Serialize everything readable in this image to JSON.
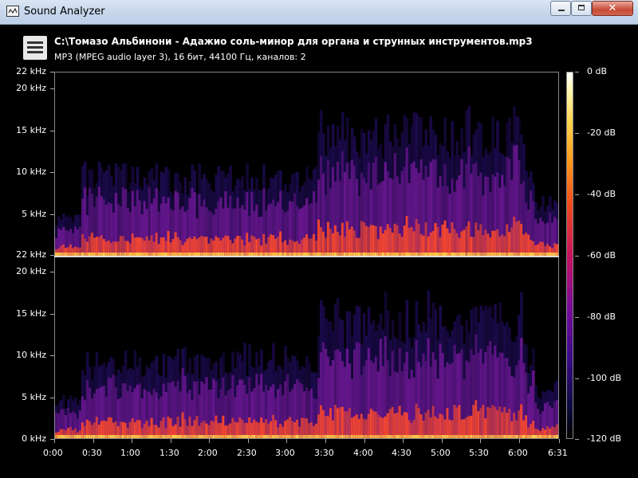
{
  "window": {
    "title": "Sound Analyzer",
    "close_label": "✕"
  },
  "header": {
    "file_path": "C:\\Томазо Альбинони - Адажио соль-минор для органа и струнных инструментов.mp3",
    "file_info": "MP3 (MPEG audio layer 3), 16 бит, 44100 Гц, каналов: 2"
  },
  "spectrogram": {
    "channels": 2,
    "top_channel_freq_labels": [
      "22 kHz",
      "20 kHz",
      "15 kHz",
      "10 kHz",
      "5 kHz"
    ],
    "bottom_channel_freq_labels": [
      "22 kHz",
      "20 kHz",
      "15 kHz",
      "10 kHz",
      "5 kHz",
      "0 kHz"
    ],
    "time_labels": [
      "0:00",
      "0:30",
      "1:00",
      "1:30",
      "2:00",
      "2:30",
      "3:00",
      "3:30",
      "4:00",
      "4:30",
      "5:00",
      "5:30",
      "6:00",
      "6:31"
    ],
    "colorbar_labels": [
      "0 dB",
      "-20 dB",
      "-40 dB",
      "-60 dB",
      "-80 dB",
      "-100 dB",
      "-120 dB"
    ],
    "colors": {
      "background": "#000000",
      "low": "#1a0a4a",
      "mid": "#7a1aa0",
      "high": "#ff4a2a",
      "peak": "#ffd24a"
    }
  }
}
